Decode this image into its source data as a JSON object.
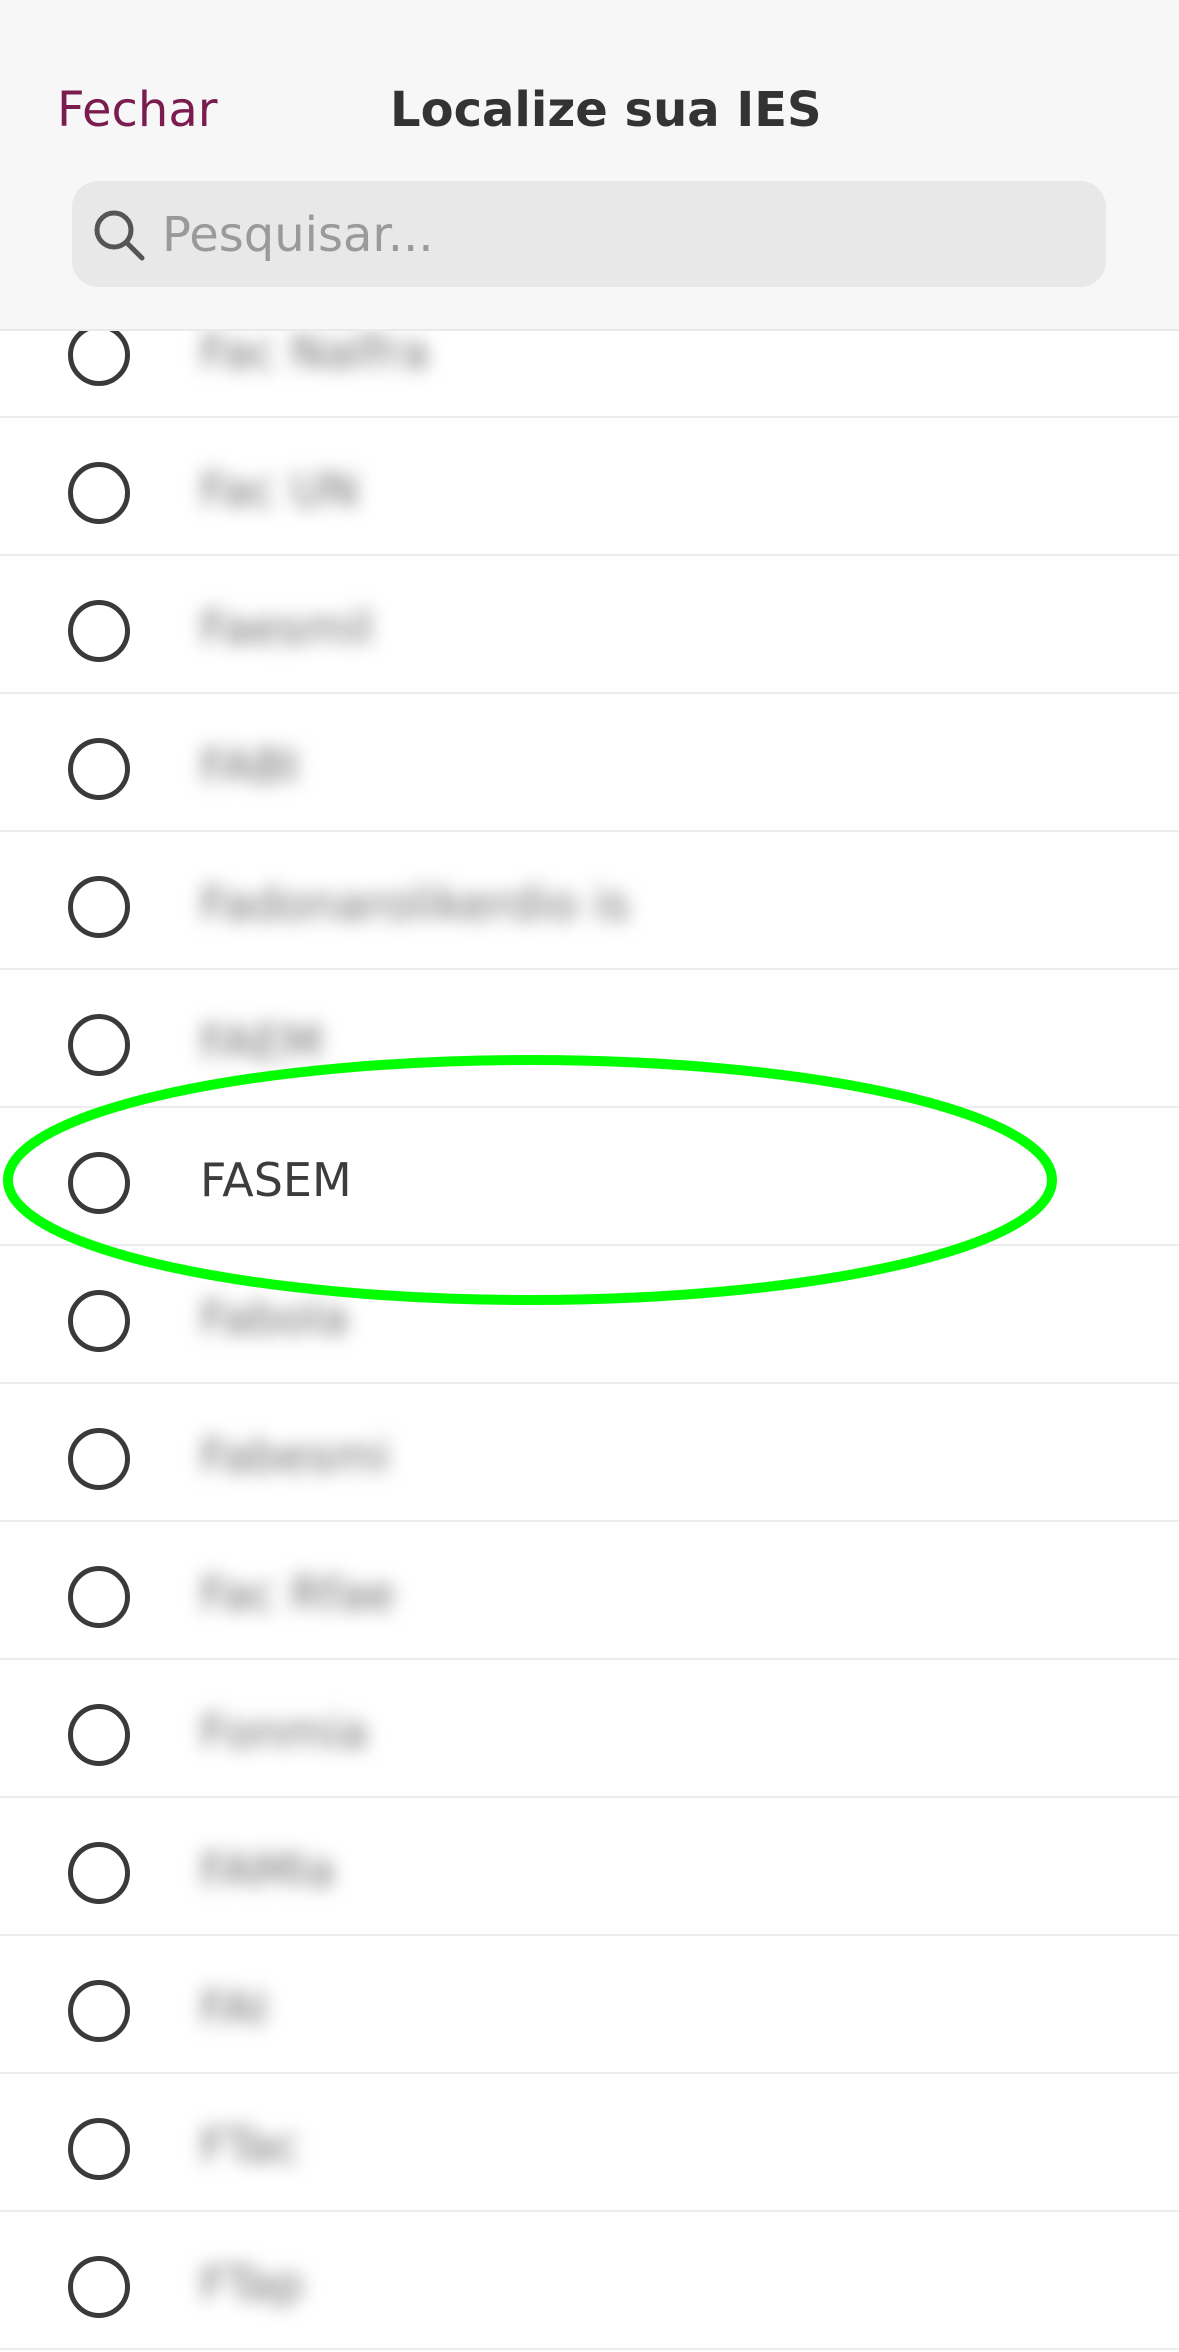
{
  "header": {
    "close_label": "Fechar",
    "title": "Localize sua IES",
    "search_placeholder": "Pesquisar..."
  },
  "list": {
    "items": [
      {
        "label": "Fac Nalfra",
        "blurred": true
      },
      {
        "label": "Fac UN",
        "blurred": true
      },
      {
        "label": "Faesmil",
        "blurred": true
      },
      {
        "label": "FABI",
        "blurred": true
      },
      {
        "label": "Fadonarolikerdio is",
        "blurred": true
      },
      {
        "label": "FAEM",
        "blurred": true
      },
      {
        "label": "FASEM",
        "blurred": false
      },
      {
        "label": "Fabola",
        "blurred": true
      },
      {
        "label": "Fabesmi",
        "blurred": true
      },
      {
        "label": "Fac Rfae",
        "blurred": true
      },
      {
        "label": "Fonmia",
        "blurred": true
      },
      {
        "label": "FAMIa",
        "blurred": true
      },
      {
        "label": "FAI",
        "blurred": true
      },
      {
        "label": "FTac",
        "blurred": true
      },
      {
        "label": "FTap",
        "blurred": true
      }
    ]
  },
  "colors": {
    "accent": "#7b1c4f",
    "highlight": "#00ff00"
  }
}
